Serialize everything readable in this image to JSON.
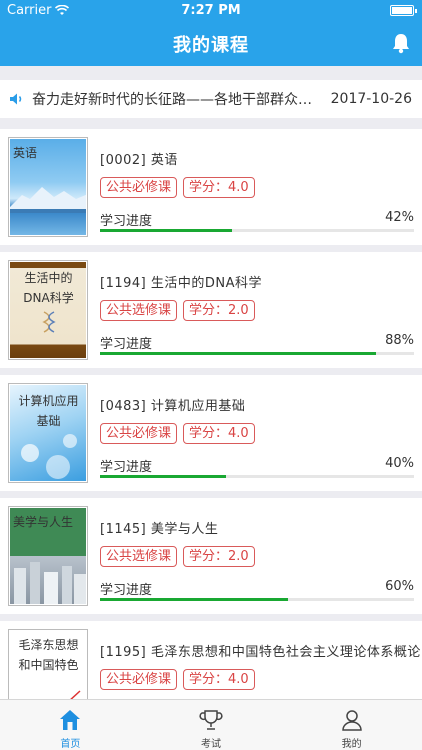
{
  "status_bar": {
    "carrier": "Carrier",
    "time": "7:27 PM"
  },
  "header": {
    "title": "我的课程"
  },
  "notice": {
    "text": "奋力走好新时代的长征路——各地干部群众热议",
    "date": "2017-10-26"
  },
  "progress_label": "学习进度",
  "courses": [
    {
      "title": "[0002] 英语",
      "cover_text": "英语",
      "tags": [
        "公共必修课",
        "学分：4.0"
      ],
      "progress_text": "42%",
      "progress": 0.42
    },
    {
      "title": "[1194] 生活中的DNA科学",
      "cover_text": "生活中的DNA科学",
      "tags": [
        "公共选修课",
        "学分：2.0"
      ],
      "progress_text": "88%",
      "progress": 0.88
    },
    {
      "title": "[0483] 计算机应用基础",
      "cover_text": "计算机应用基础",
      "tags": [
        "公共必修课",
        "学分：4.0"
      ],
      "progress_text": "40%",
      "progress": 0.4
    },
    {
      "title": "[1145] 美学与人生",
      "cover_text": "美学与人生",
      "tags": [
        "公共选修课",
        "学分：2.0"
      ],
      "progress_text": "60%",
      "progress": 0.6
    },
    {
      "title": "[1195] 毛泽东思想和中国特色社会主义理论体系概论",
      "cover_text": "毛泽东思想和中国特色",
      "tags": [
        "公共必修课",
        "学分：4.0"
      ],
      "progress_text": "",
      "progress": 0
    }
  ],
  "tabbar": [
    {
      "label": "首页",
      "icon": "home-icon",
      "active": true
    },
    {
      "label": "考试",
      "icon": "trophy-icon",
      "active": false
    },
    {
      "label": "我的",
      "icon": "user-icon",
      "active": false
    }
  ],
  "colors": {
    "header": "#29a3ea",
    "tag": "#d94444",
    "progress": "#19a832",
    "active_tab": "#1e8fe0"
  }
}
